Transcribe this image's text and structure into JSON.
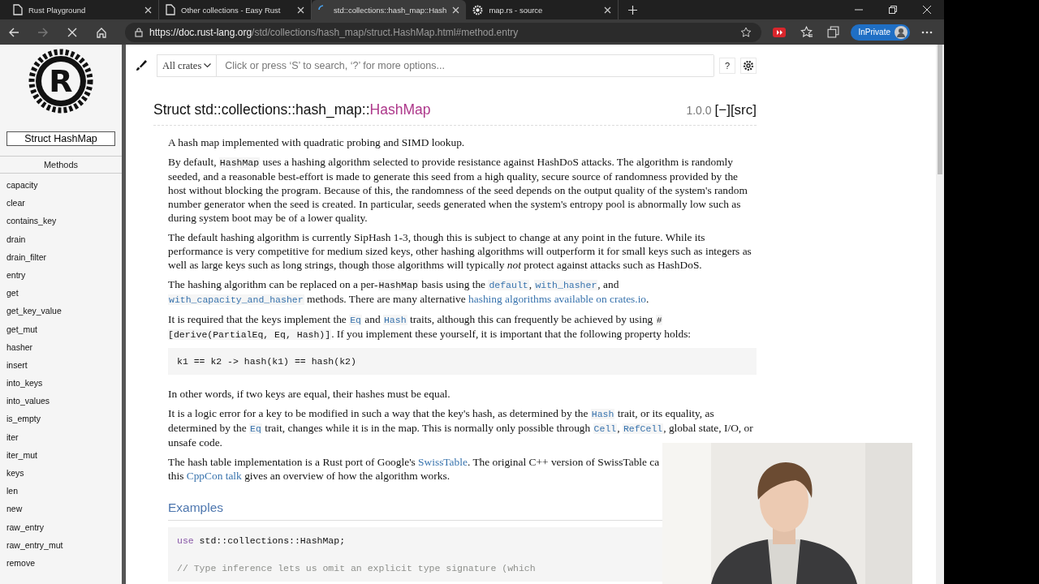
{
  "tabs": [
    {
      "title": "Rust Playground",
      "selected": false
    },
    {
      "title": "Other collections - Easy Rust",
      "selected": false
    },
    {
      "title": "std::collections::hash_map::Hash",
      "selected": true
    },
    {
      "title": "map.rs - source",
      "selected": false
    }
  ],
  "nav": [
    {
      "kind": "back",
      "disabled": false
    },
    {
      "kind": "forward",
      "disabled": true
    },
    {
      "kind": "stop",
      "disabled": false
    },
    {
      "kind": "home",
      "disabled": false
    }
  ],
  "address": {
    "host": "https://doc.rust-lang.org",
    "path": "/std/collections/hash_map/struct.HashMap.html#method.entry"
  },
  "profile": {
    "label": "InPrivate"
  },
  "sidebar": {
    "logo_letter": "R",
    "title": "Struct HashMap",
    "section": "Methods",
    "items": [
      "capacity",
      "clear",
      "contains_key",
      "drain",
      "drain_filter",
      "entry",
      "get",
      "get_key_value",
      "get_mut",
      "hasher",
      "insert",
      "into_keys",
      "into_values",
      "is_empty",
      "iter",
      "iter_mut",
      "keys",
      "len",
      "new",
      "raw_entry",
      "raw_entry_mut",
      "remove"
    ]
  },
  "search": {
    "crate": "All crates",
    "placeholder": "Click or press ‘S’ to search, ‘?’ for more options...",
    "help": "?"
  },
  "heading": {
    "prefix": "Struct std::collections::hash_map::",
    "name": "HashMap",
    "version": "1.0.0",
    "collapse": "[−]",
    "source": "[src]"
  },
  "blocks": [
    {
      "kind": "para",
      "parts": [
        {
          "kind": "text",
          "text": "A hash map implemented with quadratic probing and SIMD lookup."
        }
      ]
    },
    {
      "kind": "para",
      "parts": [
        {
          "kind": "text",
          "text": "By default, "
        },
        {
          "kind": "code",
          "text": "HashMap"
        },
        {
          "kind": "text",
          "text": " uses a hashing algorithm selected to provide resistance against HashDoS attacks. The algorithm is randomly seeded, and a reasonable best-effort is made to generate this seed from a high quality, secure source of randomness provided by the host without blocking the program. Because of this, the randomness of the seed depends on the output quality of the system's random number generator when the seed is created. In particular, seeds generated when the system's entropy pool is abnormally low such as during system boot may be of a lower quality."
        }
      ]
    },
    {
      "kind": "para",
      "parts": [
        {
          "kind": "text",
          "text": "The default hashing algorithm is currently SipHash 1-3, though this is subject to change at any point in the future. While its performance is very competitive for medium sized keys, other hashing algorithms will outperform it for small keys such as integers as well as large keys such as long strings, though those algorithms will typically "
        },
        {
          "kind": "em",
          "text": "not"
        },
        {
          "kind": "text",
          "text": " protect against attacks such as HashDoS."
        }
      ]
    },
    {
      "kind": "para",
      "parts": [
        {
          "kind": "text",
          "text": "The hashing algorithm can be replaced on a per-"
        },
        {
          "kind": "code",
          "text": "HashMap"
        },
        {
          "kind": "text",
          "text": " basis using the "
        },
        {
          "kind": "codelink",
          "text": "default"
        },
        {
          "kind": "text",
          "text": ", "
        },
        {
          "kind": "codelink",
          "text": "with_hasher"
        },
        {
          "kind": "text",
          "text": ", and "
        },
        {
          "kind": "codelink",
          "text": "with_capacity_and_hasher"
        },
        {
          "kind": "text",
          "text": " methods. There are many alternative "
        },
        {
          "kind": "link",
          "text": "hashing algorithms available on crates.io"
        },
        {
          "kind": "text",
          "text": "."
        }
      ]
    },
    {
      "kind": "para",
      "parts": [
        {
          "kind": "text",
          "text": "It is required that the keys implement the "
        },
        {
          "kind": "codelink",
          "text": "Eq"
        },
        {
          "kind": "text",
          "text": " and "
        },
        {
          "kind": "codelink",
          "text": "Hash"
        },
        {
          "kind": "text",
          "text": " traits, although this can frequently be achieved by using "
        },
        {
          "kind": "code",
          "text": "#[derive(PartialEq, Eq, Hash)]"
        },
        {
          "kind": "text",
          "text": ". If you implement these yourself, it is important that the following property holds:"
        }
      ]
    },
    {
      "kind": "code",
      "lines": [
        {
          "kind": "tokens",
          "tokens": [
            {
              "kind": "plain",
              "text": "k1 == k2 -> hash(k1) == hash(k2)"
            }
          ]
        }
      ]
    },
    {
      "kind": "para",
      "parts": [
        {
          "kind": "text",
          "text": "In other words, if two keys are equal, their hashes must be equal."
        }
      ]
    },
    {
      "kind": "para",
      "parts": [
        {
          "kind": "text",
          "text": "It is a logic error for a key to be modified in such a way that the key's hash, as determined by the "
        },
        {
          "kind": "codelink",
          "text": "Hash"
        },
        {
          "kind": "text",
          "text": " trait, or its equality, as determined by the "
        },
        {
          "kind": "codelink",
          "text": "Eq"
        },
        {
          "kind": "text",
          "text": " trait, changes while it is in the map. This is normally only possible through "
        },
        {
          "kind": "codelink",
          "text": "Cell"
        },
        {
          "kind": "text",
          "text": ", "
        },
        {
          "kind": "codelink",
          "text": "RefCell"
        },
        {
          "kind": "text",
          "text": ", global state, I/O, or unsafe code."
        }
      ]
    },
    {
      "kind": "para",
      "parts": [
        {
          "kind": "text",
          "text": "The hash table implementation is a Rust port of Google's "
        },
        {
          "kind": "link",
          "text": "SwissTable"
        },
        {
          "kind": "text",
          "text": ". The original C++ version of SwissTable ca"
        },
        {
          "kind": "break"
        },
        {
          "kind": "text",
          "text": "this "
        },
        {
          "kind": "link",
          "text": "CppCon talk"
        },
        {
          "kind": "text",
          "text": " gives an overview of how the algorithm works."
        }
      ]
    },
    {
      "kind": "heading",
      "text": "Examples"
    },
    {
      "kind": "code",
      "lines": [
        {
          "kind": "tokens",
          "tokens": [
            {
              "kind": "keyword",
              "text": "use"
            },
            {
              "kind": "plain",
              "text": " std::collections::HashMap;"
            }
          ]
        },
        {
          "kind": "blank"
        },
        {
          "kind": "tokens",
          "tokens": [
            {
              "kind": "comment",
              "text": "// Type inference lets us omit an explicit type signature (which"
            }
          ]
        }
      ]
    }
  ]
}
